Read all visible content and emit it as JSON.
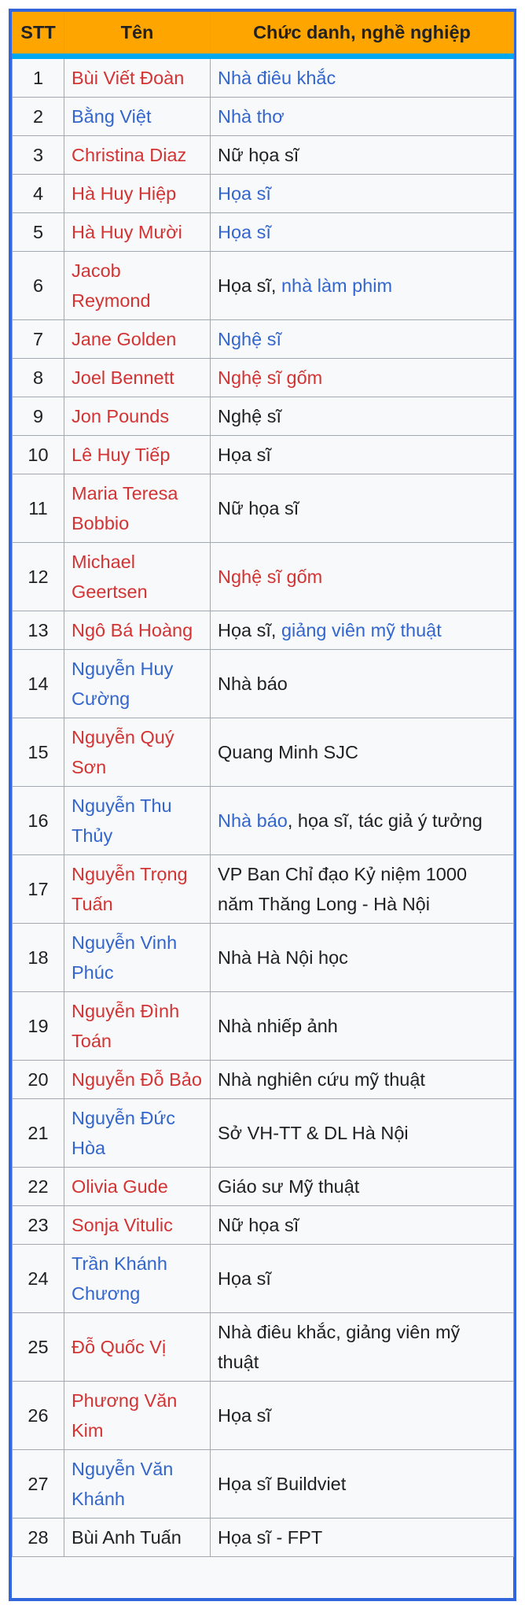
{
  "headers": [
    "STT",
    "Tên",
    "Chức danh, nghề nghiệp"
  ],
  "colors": {
    "border": "#3366dd",
    "header_bg": "#ffa500",
    "header_rule": "#00a8ef",
    "link_red": "#d33333",
    "link_blue": "#3366cc"
  },
  "rows": [
    {
      "stt": "1",
      "name": "Bùi Viết Đoàn",
      "name_style": "red",
      "role": [
        {
          "text": "Nhà điêu khắc",
          "style": "blue"
        }
      ]
    },
    {
      "stt": "2",
      "name": "Bằng Việt",
      "name_style": "blue",
      "role": [
        {
          "text": "Nhà thơ",
          "style": "blue"
        }
      ]
    },
    {
      "stt": "3",
      "name": "Christina Diaz",
      "name_style": "red",
      "role": [
        {
          "text": "Nữ họa sĩ",
          "style": "plain"
        }
      ]
    },
    {
      "stt": "4",
      "name": "Hà Huy Hiệp",
      "name_style": "red",
      "role": [
        {
          "text": "Họa sĩ",
          "style": "blue"
        }
      ]
    },
    {
      "stt": "5",
      "name": "Hà Huy Mười",
      "name_style": "red",
      "role": [
        {
          "text": "Họa sĩ",
          "style": "blue"
        }
      ]
    },
    {
      "stt": "6",
      "name": "Jacob Reymond",
      "name_style": "red",
      "role": [
        {
          "text": "Họa sĩ, ",
          "style": "plain"
        },
        {
          "text": "nhà làm phim",
          "style": "blue"
        }
      ]
    },
    {
      "stt": "7",
      "name": "Jane Golden",
      "name_style": "red",
      "role": [
        {
          "text": "Nghệ sĩ",
          "style": "blue"
        }
      ]
    },
    {
      "stt": "8",
      "name": "Joel Bennett",
      "name_style": "red",
      "role": [
        {
          "text": "Nghệ sĩ gốm",
          "style": "red"
        }
      ]
    },
    {
      "stt": "9",
      "name": "Jon Pounds",
      "name_style": "red",
      "role": [
        {
          "text": "Nghệ sĩ",
          "style": "plain"
        }
      ]
    },
    {
      "stt": "10",
      "name": "Lê Huy Tiếp",
      "name_style": "red",
      "role": [
        {
          "text": "Họa sĩ",
          "style": "plain"
        }
      ]
    },
    {
      "stt": "11",
      "name": "Maria Teresa Bobbio",
      "name_style": "red",
      "role": [
        {
          "text": "Nữ họa sĩ",
          "style": "plain"
        }
      ]
    },
    {
      "stt": "12",
      "name": "Michael Geertsen",
      "name_style": "red",
      "role": [
        {
          "text": "Nghệ sĩ gốm",
          "style": "red"
        }
      ]
    },
    {
      "stt": "13",
      "name": "Ngô Bá Hoàng",
      "name_style": "red",
      "role": [
        {
          "text": "Họa sĩ, ",
          "style": "plain"
        },
        {
          "text": "giảng viên mỹ thuật",
          "style": "blue"
        }
      ]
    },
    {
      "stt": "14",
      "name": "Nguyễn Huy Cường",
      "name_style": "blue",
      "role": [
        {
          "text": "Nhà báo",
          "style": "plain"
        }
      ]
    },
    {
      "stt": "15",
      "name": "Nguyễn Quý Sơn",
      "name_style": "red",
      "role": [
        {
          "text": "Quang Minh SJC",
          "style": "plain"
        }
      ]
    },
    {
      "stt": "16",
      "name": "Nguyễn Thu Thủy",
      "name_style": "blue",
      "role": [
        {
          "text": "Nhà báo",
          "style": "blue"
        },
        {
          "text": ", họa sĩ, tác giả ý tưởng",
          "style": "plain"
        }
      ]
    },
    {
      "stt": "17",
      "name": "Nguyễn Trọng Tuấn",
      "name_style": "red",
      "role": [
        {
          "text": "VP Ban Chỉ đạo Kỷ niệm 1000 năm Thăng Long - Hà Nội",
          "style": "plain"
        }
      ]
    },
    {
      "stt": "18",
      "name": "Nguyễn Vinh Phúc",
      "name_style": "blue",
      "role": [
        {
          "text": "Nhà Hà Nội học",
          "style": "plain"
        }
      ]
    },
    {
      "stt": "19",
      "name": "Nguyễn Đình Toán",
      "name_style": "red",
      "role": [
        {
          "text": "Nhà nhiếp ảnh",
          "style": "plain"
        }
      ]
    },
    {
      "stt": "20",
      "name": "Nguyễn Đỗ Bảo",
      "name_style": "red",
      "role": [
        {
          "text": "Nhà nghiên cứu mỹ thuật",
          "style": "plain"
        }
      ]
    },
    {
      "stt": "21",
      "name": "Nguyễn Đức Hòa",
      "name_style": "blue",
      "role": [
        {
          "text": "Sở VH-TT & DL Hà Nội",
          "style": "plain"
        }
      ]
    },
    {
      "stt": "22",
      "name": "Olivia Gude",
      "name_style": "red",
      "role": [
        {
          "text": "Giáo sư Mỹ thuật",
          "style": "plain"
        }
      ]
    },
    {
      "stt": "23",
      "name": "Sonja Vitulic",
      "name_style": "red",
      "role": [
        {
          "text": "Nữ họa sĩ",
          "style": "plain"
        }
      ]
    },
    {
      "stt": "24",
      "name": "Trần Khánh Chương",
      "name_style": "blue",
      "role": [
        {
          "text": "Họa sĩ",
          "style": "plain"
        }
      ]
    },
    {
      "stt": "25",
      "name": "Đỗ Quốc Vị",
      "name_style": "red",
      "role": [
        {
          "text": "Nhà điêu khắc, giảng viên mỹ thuật",
          "style": "plain"
        }
      ]
    },
    {
      "stt": "26",
      "name": "Phương Văn Kim",
      "name_style": "red",
      "role": [
        {
          "text": "Họa sĩ",
          "style": "plain"
        }
      ]
    },
    {
      "stt": "27",
      "name": "Nguyễn Văn Khánh",
      "name_style": "blue",
      "role": [
        {
          "text": "Họa sĩ Buildviet",
          "style": "plain"
        }
      ]
    },
    {
      "stt": "28",
      "name": "Bùi Anh Tuấn",
      "name_style": "plain",
      "role": [
        {
          "text": "Họa sĩ - FPT",
          "style": "plain"
        }
      ]
    }
  ]
}
